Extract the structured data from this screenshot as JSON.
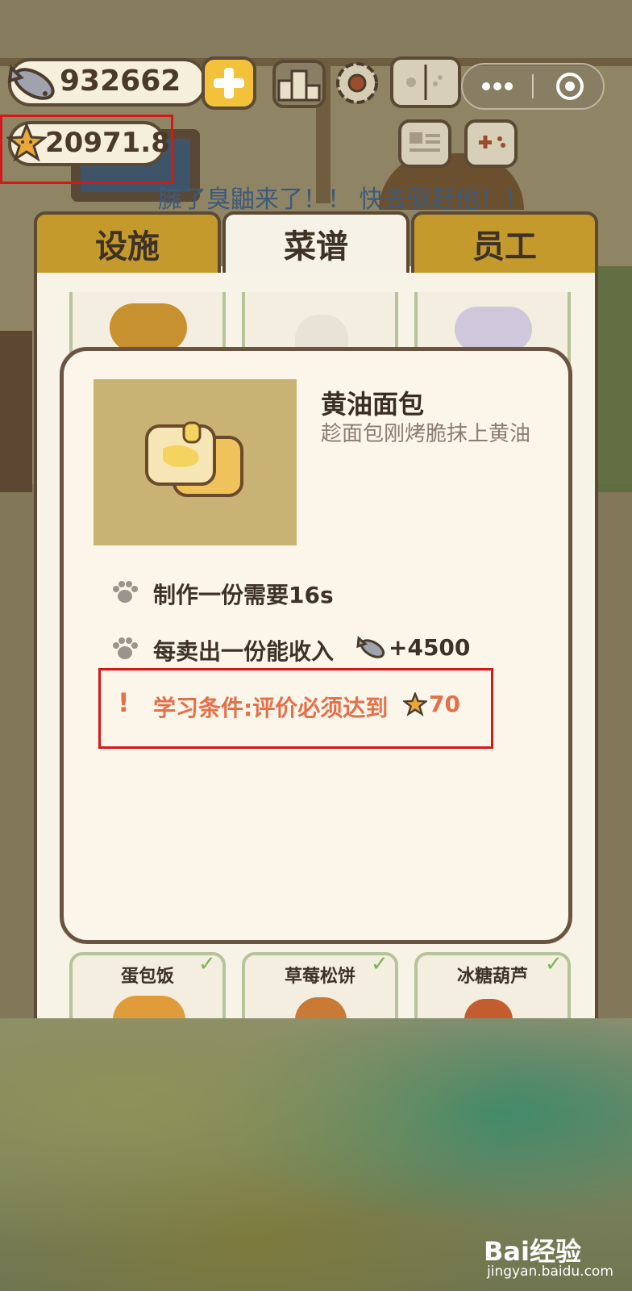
{
  "hud": {
    "fish_count": "932662",
    "star_rating": "20971.8"
  },
  "banner_text": "臃了臭鼬来了！！ 快去驱赶他！！",
  "tabs": [
    {
      "label": "设施"
    },
    {
      "label": "菜谱"
    },
    {
      "label": "员工"
    }
  ],
  "recipe": {
    "name": "黄油面包",
    "description": "趁面包刚烤脆抹上黄油",
    "make_time": "制作一份需要16s",
    "income_label": "每卖出一份能收入",
    "income_value": "+4500",
    "condition_label": "学习条件:评价必须达到",
    "condition_value": "70"
  },
  "bottom_cards": [
    {
      "label": "蛋包饭"
    },
    {
      "label": "草莓松饼"
    },
    {
      "label": "冰糖葫芦"
    }
  ],
  "watermark": {
    "brand": "Bai经验",
    "url": "jingyan.baidu.com"
  },
  "colors": {
    "tab_inactive": "#c59a2d",
    "tab_active": "#f6f2e8",
    "warning": "#e4704a",
    "highlight_box": "#d21a1a"
  }
}
